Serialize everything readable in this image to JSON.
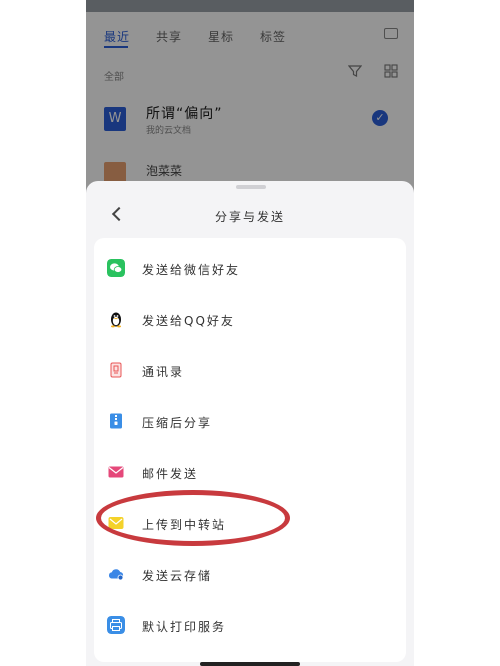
{
  "background_app": {
    "tabs": [
      "最近",
      "共享",
      "星标",
      "标签"
    ],
    "filter_label": "全部",
    "files": [
      {
        "name": "所谓“偏向”",
        "meta": "我的云文档",
        "icon": "word-icon",
        "icon_glyph": "W",
        "selected": true
      },
      {
        "name": "泡菜菜",
        "meta": "",
        "icon": "image-icon"
      }
    ]
  },
  "sheet": {
    "title": "分享与发送",
    "back_icon": "chevron-left-icon",
    "items": [
      {
        "label": "发送给微信好友",
        "icon": "wechat-icon",
        "color": "#2ac25f"
      },
      {
        "label": "发送给QQ好友",
        "icon": "qq-penguin-icon",
        "color": "#111111"
      },
      {
        "label": "通讯录",
        "icon": "contacts-icon",
        "color": "#e85656"
      },
      {
        "label": "压缩后分享",
        "icon": "zip-icon",
        "color": "#3a8ee6"
      },
      {
        "label": "邮件发送",
        "icon": "mail-icon",
        "color": "#e5487a"
      },
      {
        "label": "上传到中转站",
        "icon": "transfer-station-icon",
        "color": "#f4d22a"
      },
      {
        "label": "发送云存储",
        "icon": "cloud-upload-icon",
        "color": "#3a86e6"
      },
      {
        "label": "默认打印服务",
        "icon": "printer-icon",
        "color": "#3a8ee6"
      }
    ]
  },
  "annotation": {
    "highlighted_item": "上传到中转站",
    "color": "#c83a3e"
  }
}
